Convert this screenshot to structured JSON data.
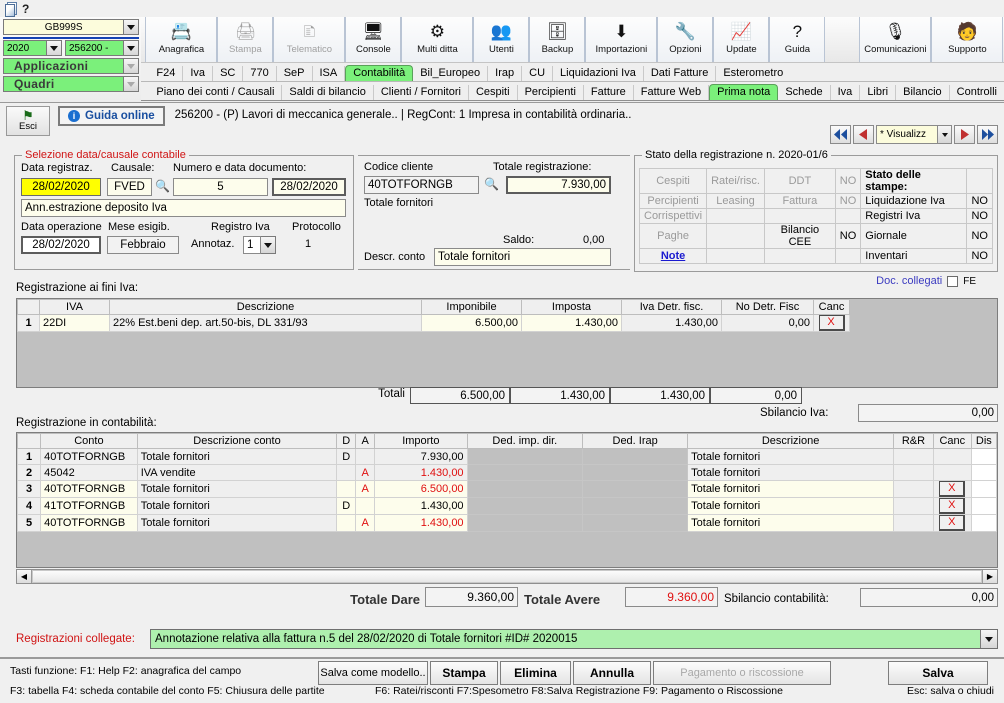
{
  "window": {
    "help_glyph": "?"
  },
  "company_selector": {
    "company_code": "GB999S",
    "year": "2020",
    "client_code": "256200 -",
    "applications_label": "Applicazioni",
    "quadri_label": "Quadri"
  },
  "toolbar": [
    {
      "name": "anagrafica",
      "label": "Anagrafica",
      "icon": "id-card-icon",
      "glyph": "📇",
      "disabled": false
    },
    {
      "name": "stampa",
      "label": "Stampa",
      "icon": "printer-icon",
      "glyph": "🖨",
      "disabled": true
    },
    {
      "name": "telematico",
      "label": "Telematico",
      "icon": "documents-icon",
      "glyph": "🗈",
      "disabled": true
    },
    {
      "name": "console",
      "label": "Console",
      "icon": "monitor-icon",
      "glyph": "🖥",
      "disabled": false
    },
    {
      "name": "multi-ditta",
      "label": "Multi ditta",
      "icon": "network-icon",
      "glyph": "⚙",
      "disabled": false
    },
    {
      "name": "utenti",
      "label": "Utenti",
      "icon": "users-icon",
      "glyph": "👥",
      "disabled": false
    },
    {
      "name": "backup",
      "label": "Backup",
      "icon": "database-icon",
      "glyph": "🗄",
      "disabled": false
    },
    {
      "name": "importazioni",
      "label": "Importazioni",
      "icon": "import-icon",
      "glyph": "⬇",
      "disabled": false
    },
    {
      "name": "opzioni",
      "label": "Opzioni",
      "icon": "wrench-icon",
      "glyph": "🔧",
      "disabled": false
    },
    {
      "name": "update",
      "label": "Update",
      "icon": "chart-monitor-icon",
      "glyph": "📈",
      "disabled": false
    },
    {
      "name": "guida",
      "label": "Guida",
      "icon": "question-circle-icon",
      "glyph": "?",
      "disabled": false
    }
  ],
  "toolbar_right": [
    {
      "name": "comunicazioni",
      "label": "Comunicazioni",
      "icon": "megaphone-icon",
      "glyph": "🎙",
      "disabled": false
    },
    {
      "name": "supporto",
      "label": "Supporto",
      "icon": "support-icon",
      "glyph": "🧑",
      "disabled": false
    }
  ],
  "tabs_primary": [
    {
      "label": "F24",
      "active": false
    },
    {
      "label": "Iva",
      "active": false
    },
    {
      "label": "SC",
      "active": false
    },
    {
      "label": "770",
      "active": false
    },
    {
      "label": "SeP",
      "active": false
    },
    {
      "label": "ISA",
      "active": false
    },
    {
      "label": "Contabilità",
      "active": true
    },
    {
      "label": "Bil_Europeo",
      "active": false
    },
    {
      "label": "Irap",
      "active": false
    },
    {
      "label": "CU",
      "active": false
    },
    {
      "label": "Liquidazioni Iva",
      "active": false
    },
    {
      "label": "Dati Fatture",
      "active": false
    },
    {
      "label": "Esterometro",
      "active": false
    }
  ],
  "tabs_secondary": [
    {
      "label": "Piano dei conti / Causali",
      "active": false
    },
    {
      "label": "Saldi di bilancio",
      "active": false
    },
    {
      "label": "Clienti / Fornitori",
      "active": false
    },
    {
      "label": "Cespiti",
      "active": false
    },
    {
      "label": "Percipienti",
      "active": false
    },
    {
      "label": "Fatture",
      "active": false
    },
    {
      "label": "Fatture Web",
      "active": false
    },
    {
      "label": "Prima nota",
      "active": true
    },
    {
      "label": "Schede",
      "active": false
    },
    {
      "label": "Iva",
      "active": false
    },
    {
      "label": "Libri",
      "active": false
    },
    {
      "label": "Bilancio",
      "active": false
    },
    {
      "label": "Controlli",
      "active": false
    }
  ],
  "header": {
    "esc_label": "Esci",
    "guida_online_label": "Guida online",
    "title": "256200 - (P) Lavori di meccanica generale.. | RegCont: 1 Impresa  in contabilità ordinaria..",
    "nav": {
      "first": "◀◀",
      "prev": "◀",
      "select_value": "* Visualizz",
      "next": "▶",
      "last": "▶▶"
    }
  },
  "selezione": {
    "legend": "Selezione data/causale contabile",
    "data_registraz_label": "Data registraz.",
    "data_registraz_value": "28/02/2020",
    "causale_label": "Causale:",
    "causale_value": "FVED",
    "numero_data_label": "Numero e data documento:",
    "numero_value": "5",
    "data_doc_value": "28/02/2020",
    "descrizione_value": "Ann.estrazione deposito Iva",
    "data_operazione_label": "Data operazione",
    "data_operazione_value": "28/02/2020",
    "mese_esigib_label": "Mese esigib.",
    "mese_esigib_value": "Febbraio",
    "registro_iva_label": "Registro Iva",
    "annotaz_label": "Annotaz.",
    "annotaz_value": "1",
    "protocollo_label": "Protocollo",
    "protocollo_value": "1"
  },
  "cliente": {
    "codice_cliente_label": "Codice cliente",
    "codice_cliente_value": "40TOTFORNGB",
    "totale_registrazione_label": "Totale registrazione:",
    "totale_registrazione_value": "7.930,00",
    "totale_fornitori_text": "Totale fornitori",
    "saldo_label": "Saldo:",
    "saldo_value": "0,00",
    "descr_conto_label": "Descr. conto",
    "descr_conto_value": "Totale fornitori"
  },
  "stato": {
    "legend": "Stato della registrazione n. 2020-01/6",
    "rows": [
      {
        "c1": "Cespiti",
        "c2": "Ratei/risc.",
        "c3": "DDT",
        "c4": "NO",
        "c5": "Stato delle stampe:",
        "c6": ""
      },
      {
        "c1": "Percipienti",
        "c2": "Leasing",
        "c3": "Fattura",
        "c4": "NO",
        "c5": "Liquidazione Iva",
        "c6": "NO"
      },
      {
        "c1": "Corrispettivi",
        "c2": "",
        "c3": "",
        "c4": "",
        "c5": "Registri Iva",
        "c6": "NO"
      },
      {
        "c1": "Paghe",
        "c2": "",
        "c3": "Bilancio CEE",
        "c4": "NO",
        "c5": "Giornale",
        "c6": "NO"
      },
      {
        "c1": "Note",
        "c2": "",
        "c3": "",
        "c4": "",
        "c5": "Inventari",
        "c6": "NO"
      }
    ],
    "doc_collegati_label": "Doc. collegati",
    "fe_label": "FE"
  },
  "iva_section": {
    "title": "Registrazione ai fini Iva:",
    "columns": [
      "",
      "IVA",
      "Descrizione",
      "Imponibile",
      "Imposta",
      "Iva Detr. fisc.",
      "No Detr. Fisc",
      "Canc"
    ],
    "rows": [
      {
        "n": "1",
        "iva": "22DI",
        "descrizione": "22% Est.beni dep. art.50-bis, DL 331/93",
        "imponibile": "6.500,00",
        "imposta": "1.430,00",
        "iva_detr": "1.430,00",
        "no_detr": "0,00",
        "canc": "X"
      }
    ],
    "totali_label": "Totali",
    "totali": {
      "imponibile": "6.500,00",
      "imposta": "1.430,00",
      "iva_detr": "1.430,00",
      "no_detr": "0,00"
    },
    "sbilancio_label": "Sbilancio Iva:",
    "sbilancio_value": "0,00"
  },
  "cont_section": {
    "title": "Registrazione in contabilità:",
    "columns": [
      "",
      "Conto",
      "Descrizione conto",
      "D",
      "A",
      "Importo",
      "Ded. imp. dir.",
      "Ded. Irap",
      "Descrizione",
      "R&R",
      "Canc",
      "Dis"
    ],
    "rows": [
      {
        "n": "1",
        "conto": "40TOTFORNGB",
        "descr_conto": "Totale fornitori",
        "d": "D",
        "a": "",
        "importo": "7.930,00",
        "importo_red": false,
        "ded_imp": "",
        "ded_irap": "",
        "descrizione": "Totale fornitori",
        "rr": "",
        "canc": "",
        "highlight": false
      },
      {
        "n": "2",
        "conto": "45042",
        "descr_conto": "IVA vendite",
        "d": "",
        "a": "A",
        "importo": "1.430,00",
        "importo_red": true,
        "ded_imp": "",
        "ded_irap": "",
        "descrizione": "Totale fornitori",
        "rr": "",
        "canc": "",
        "highlight": false
      },
      {
        "n": "3",
        "conto": "40TOTFORNGB",
        "descr_conto": "Totale fornitori",
        "d": "",
        "a": "A",
        "importo": "6.500,00",
        "importo_red": true,
        "ded_imp": "",
        "ded_irap": "",
        "descrizione": "Totale fornitori",
        "rr": "",
        "canc": "X",
        "highlight": true
      },
      {
        "n": "4",
        "conto": "41TOTFORNGB",
        "descr_conto": "Totale fornitori",
        "d": "D",
        "a": "",
        "importo": "1.430,00",
        "importo_red": false,
        "ded_imp": "",
        "ded_irap": "",
        "descrizione": "Totale fornitori",
        "rr": "",
        "canc": "X",
        "highlight": true
      },
      {
        "n": "5",
        "conto": "40TOTFORNGB",
        "descr_conto": "Totale fornitori",
        "d": "",
        "a": "A",
        "importo": "1.430,00",
        "importo_red": true,
        "ded_imp": "",
        "ded_irap": "",
        "descrizione": "Totale fornitori",
        "rr": "",
        "canc": "X",
        "highlight": true
      }
    ],
    "totale_dare_label": "Totale Dare",
    "totale_dare_value": "9.360,00",
    "totale_avere_label": "Totale Avere",
    "totale_avere_value": "9.360,00",
    "sbilancio_label": "Sbilancio contabilità:",
    "sbilancio_value": "0,00"
  },
  "registrazioni_collegate": {
    "label": "Registrazioni collegate:",
    "value": "Annotazione relativa alla fattura n.5 del 28/02/2020 di Totale fornitori #ID# 2020015"
  },
  "footer": {
    "line1": "Tasti funzione: F1: Help  F2: anagrafica del campo",
    "line2": "F3: tabella   F4: scheda contabile del conto  F5: Chiusura delle partite",
    "line3": "F6: Ratei/risconti   F7:Spesometro   F8:Salva Registrazione    F9: Pagamento o Riscossione",
    "esc_note": "Esc: salva o chiudi",
    "buttons": [
      {
        "name": "salva-come-modello",
        "label": "Salva come modello..",
        "bold": false,
        "disabled": false
      },
      {
        "name": "stampa",
        "label": "Stampa",
        "bold": true,
        "disabled": false
      },
      {
        "name": "elimina",
        "label": "Elimina",
        "bold": true,
        "disabled": false
      },
      {
        "name": "annulla",
        "label": "Annulla",
        "bold": true,
        "disabled": false
      },
      {
        "name": "pagamento",
        "label": "Pagamento o riscossione",
        "bold": false,
        "disabled": true
      }
    ],
    "salva_label": "Salva"
  },
  "colors": {
    "accent_green": "#7bf07b",
    "highlight_yellow": "#ffff00",
    "red_text": "#e01010",
    "link_blue": "#1a1ad0"
  }
}
